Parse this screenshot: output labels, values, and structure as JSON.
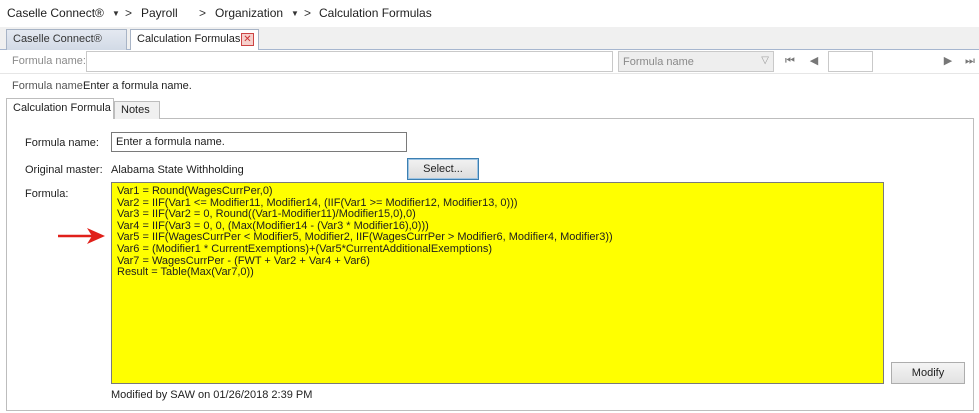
{
  "breadcrumb": {
    "items": [
      "Caselle Connect®",
      "Payroll",
      "Organization",
      "Calculation Formulas"
    ]
  },
  "doc_tabs": [
    {
      "label": "Caselle Connect®",
      "active": false
    },
    {
      "label": "Calculation Formulas",
      "active": true
    }
  ],
  "search": {
    "label": "Formula name:",
    "value": "",
    "combo_value": "Formula name"
  },
  "header": {
    "label": "Formula name:",
    "value": "Enter a formula name."
  },
  "inner_tabs": [
    {
      "label": "Calculation Formula",
      "active": true
    },
    {
      "label": "Notes",
      "active": false
    }
  ],
  "form": {
    "name_label": "Formula name:",
    "name_value": "Enter a formula name.",
    "master_label": "Original master:",
    "master_value": "Alabama State Withholding",
    "select_label": "Select...",
    "formula_label": "Formula:",
    "formula_lines": [
      "Var1 = Round(WagesCurrPer,0)",
      "Var2 = IIF(Var1 <= Modifier11, Modifier14, (IIF(Var1 >= Modifier12, Modifier13, 0)))",
      "Var3 = IIF(Var2 = 0, Round((Var1-Modifier11)/Modifier15,0),0)",
      "Var4 = IIF(Var3 = 0, 0, (Max(Modifier14 - (Var3 * Modifier16),0)))",
      "Var5 = IIF(WagesCurrPer < Modifier5, Modifier2, IIF(WagesCurrPer > Modifier6, Modifier4, Modifier3))",
      "Var6 = (Modifier1 * CurrentExemptions)+(Var5*CurrentAdditionalExemptions)",
      "Var7 = WagesCurrPer - (FWT + Var2 + Var4 + Var6)",
      "Result = Table(Max(Var7,0))"
    ],
    "modify_label": "Modify",
    "modified_text": "Modified by SAW on 01/26/2018 2:39 PM"
  },
  "colors": {
    "formula_bg": "#ffff00",
    "annotation_arrow": "#e0201a",
    "select_border": "#3c7fb1"
  },
  "icons": {
    "breadcrumb_dropdown": "chevron-down-icon",
    "tab_close": "close-icon",
    "nav_first": "first-page-icon",
    "nav_prev": "previous-page-icon",
    "nav_next": "next-page-icon",
    "nav_last": "last-page-icon",
    "annotation": "red-arrow-icon"
  }
}
